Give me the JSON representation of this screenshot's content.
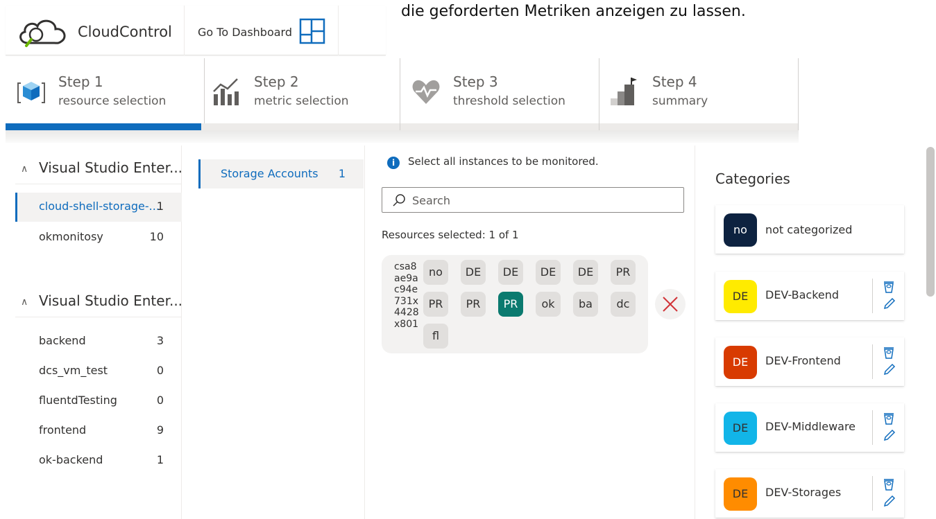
{
  "caption": "die geforderten Metriken anzeigen zu lassen.",
  "app": {
    "name": "CloudControl",
    "dashboard_link": "Go To Dashboard"
  },
  "steps": [
    {
      "title": "Step 1",
      "subtitle": "resource selection",
      "icon": "cube-icon",
      "active": true
    },
    {
      "title": "Step 2",
      "subtitle": "metric selection",
      "icon": "chart-icon",
      "active": false
    },
    {
      "title": "Step 3",
      "subtitle": "threshold selection",
      "icon": "heartbeat-icon",
      "active": false
    },
    {
      "title": "Step 4",
      "subtitle": "summary",
      "icon": "stairs-flag-icon",
      "active": false
    }
  ],
  "subscriptions": [
    {
      "title": "Visual Studio Enter...",
      "groups": [
        {
          "name": "cloud-shell-storage-...",
          "count": "1",
          "selected": true
        },
        {
          "name": "okmonitosy",
          "count": "10",
          "selected": false
        }
      ]
    },
    {
      "title": "Visual Studio Enter...",
      "groups": [
        {
          "name": "backend",
          "count": "3"
        },
        {
          "name": "dcs_vm_test",
          "count": "0"
        },
        {
          "name": "fluentdTesting",
          "count": "0"
        },
        {
          "name": "frontend",
          "count": "9"
        },
        {
          "name": "ok-backend",
          "count": "1"
        }
      ]
    }
  ],
  "resource_types": [
    {
      "name": "Storage Accounts",
      "count": "1"
    }
  ],
  "main": {
    "info": "Select all instances to be monitored.",
    "search_placeholder": "Search",
    "selected_text": "Resources selected: 1 of 1",
    "resource": {
      "id_lines": [
        "csa8",
        "ae9a",
        "c94e",
        "731x",
        "4428",
        "x801"
      ],
      "tags": [
        "no",
        "DE",
        "DE",
        "DE",
        "DE",
        "PR",
        "PR",
        "PR",
        "PR",
        "ok",
        "ba",
        "dc",
        "fl"
      ],
      "active_tag_index": 8
    }
  },
  "categories": {
    "title": "Categories",
    "items": [
      {
        "badge": "no",
        "name": "not categorized",
        "color": "#0d2240",
        "text_color": "#ffffff",
        "actions": false
      },
      {
        "badge": "DE",
        "name": "DEV-Backend",
        "color": "#ffeb00",
        "text_color": "#323130",
        "actions": true
      },
      {
        "badge": "DE",
        "name": "DEV-Frontend",
        "color": "#d83b01",
        "text_color": "#ffffff",
        "actions": true
      },
      {
        "badge": "DE",
        "name": "DEV-Middleware",
        "color": "#12b5e8",
        "text_color": "#323130",
        "actions": true
      },
      {
        "badge": "DE",
        "name": "DEV-Storages",
        "color": "#ff8c00",
        "text_color": "#323130",
        "actions": true
      }
    ]
  },
  "colors": {
    "accent": "#0f6cbd",
    "active_tag": "#0b7a6f"
  }
}
